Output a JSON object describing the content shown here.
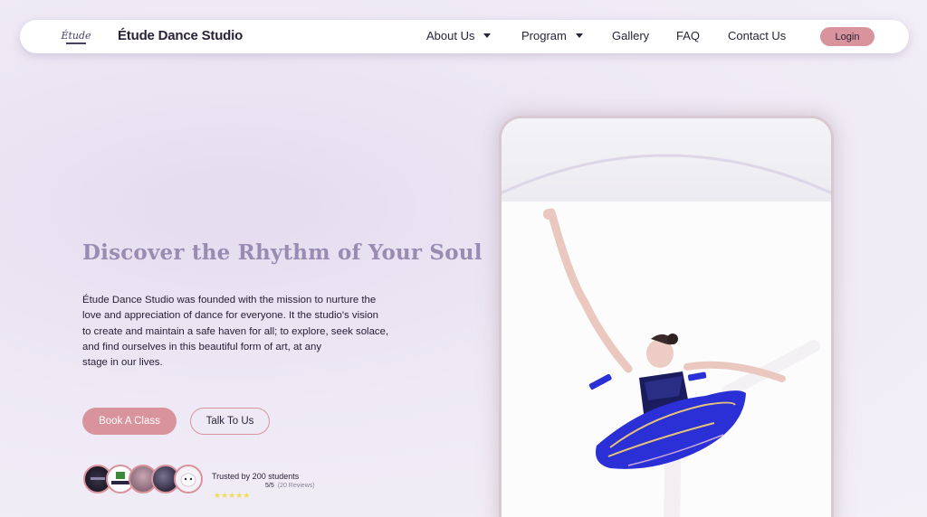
{
  "header": {
    "logo_text": "Étude",
    "brand": "Étude Dance Studio",
    "nav": [
      {
        "label": "About Us",
        "dropdown": true
      },
      {
        "label": "Program",
        "dropdown": true
      },
      {
        "label": "Gallery",
        "dropdown": false
      },
      {
        "label": "FAQ",
        "dropdown": false
      },
      {
        "label": "Contact Us",
        "dropdown": false
      }
    ],
    "login_label": "Login"
  },
  "hero": {
    "title": "Discover the Rhythm of Your Soul",
    "description_lines": [
      "Étude Dance Studio was founded with the mission to nurture the",
      "love and appreciation of dance for everyone. It the studio's vision",
      "to create and maintain a safe haven for all; to explore, seek solace,",
      "and find ourselves in this beautiful form of art, at any",
      "stage in our lives."
    ],
    "book_label": "Book A Class",
    "talk_label": "Talk To Us"
  },
  "trust": {
    "text": "Trusted by 200 students",
    "rating": "5/5",
    "reviews": "(20 Reviews)",
    "stars": "★★★★★",
    "star_count": 5,
    "star_color": "#f2dc4c"
  },
  "colors": {
    "accent": "#d9939d",
    "title": "#9a8bb3",
    "text": "#2a2338",
    "tutu_blue": "#2b2fd6"
  },
  "icons": [
    "logo-icon",
    "chevron-down-icon",
    "star-icon"
  ]
}
